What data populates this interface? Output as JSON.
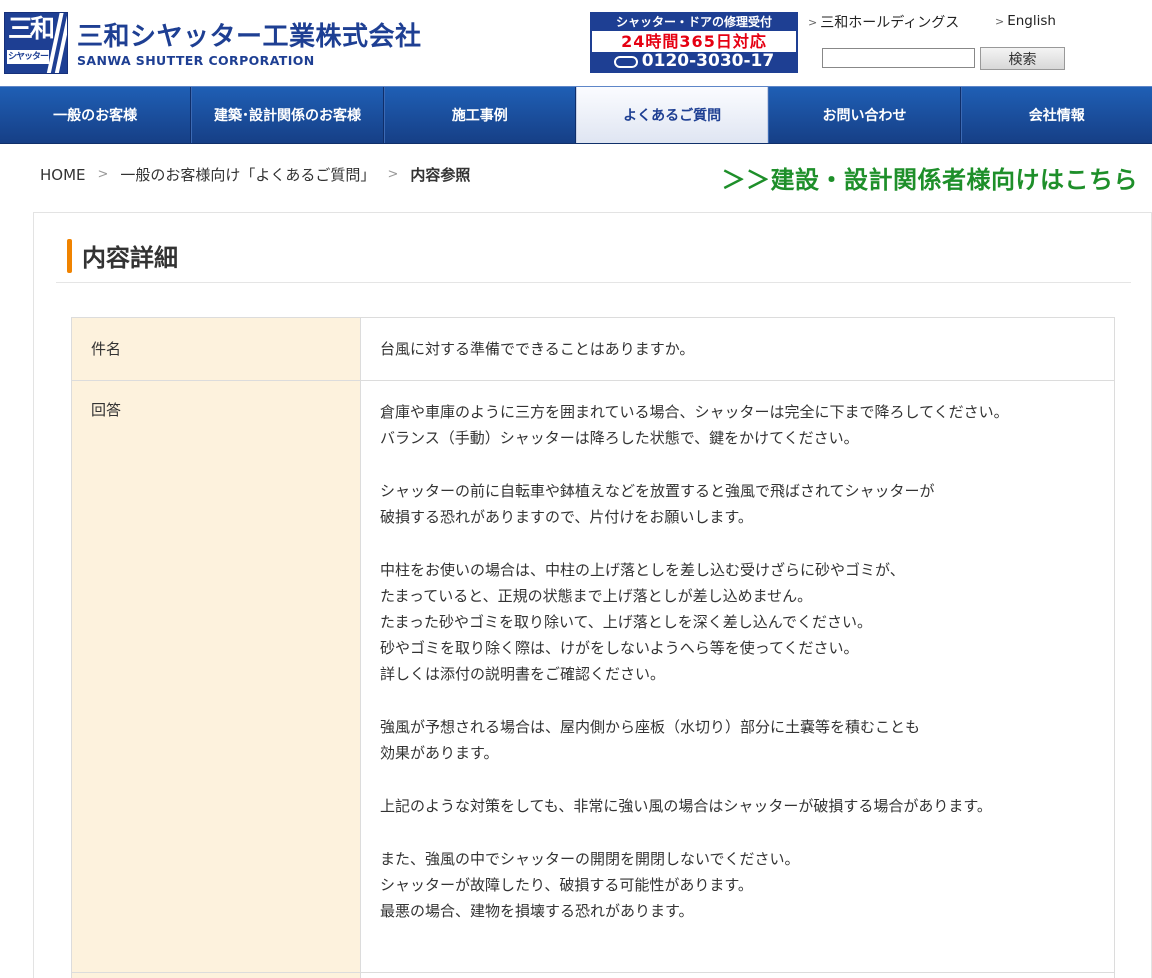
{
  "header": {
    "logo_mark_top": "三和",
    "logo_mark_bottom": "シヤッター",
    "company_name_jp": "三和シヤッター工業株式会社",
    "company_name_en": "SANWA SHUTTER CORPORATION",
    "repair_banner": {
      "line1": "シャッター・ドアの修理受付",
      "line2": "24時間365日対応",
      "phone": "0120-3030-17"
    },
    "links": {
      "holdings": "三和ホールディングス",
      "english": "English"
    },
    "search": {
      "value": "",
      "placeholder": "",
      "button_label": "検索"
    }
  },
  "nav": {
    "items": [
      {
        "label": "一般のお客様",
        "active": false
      },
      {
        "label": "建築･設計関係のお客様",
        "active": false
      },
      {
        "label": "施工事例",
        "active": false
      },
      {
        "label": "よくあるご質問",
        "active": true
      },
      {
        "label": "お問い合わせ",
        "active": false
      },
      {
        "label": "会社情報",
        "active": false
      }
    ]
  },
  "breadcrumb": {
    "home": "HOME",
    "faq": "一般のお客様向け「よくあるご質問」",
    "current": "内容参照"
  },
  "construction_link": "＞＞建設・設計関係者様向けはこちら",
  "content": {
    "title": "内容詳細",
    "subject_label": "件名",
    "subject_value": "台風に対する準備でできることはありますか。",
    "answer_label": "回答",
    "answer_paragraphs": [
      [
        "倉庫や車庫のように三方を囲まれている場合、シャッターは完全に下まで降ろしてください。",
        "バランス（手動）シャッターは降ろした状態で、鍵をかけてください。"
      ],
      [
        "シャッターの前に自転車や鉢植えなどを放置すると強風で飛ばされてシャッターが",
        "破損する恐れがありますので、片付けをお願いします。"
      ],
      [
        "中柱をお使いの場合は、中柱の上げ落としを差し込む受けざらに砂やゴミが、",
        "たまっていると、正規の状態まで上げ落としが差し込めません。",
        "たまった砂やゴミを取り除いて、上げ落としを深く差し込んでください。",
        "砂やゴミを取り除く際は、けがをしないようへら等を使ってください。",
        "詳しくは添付の説明書をご確認ください。"
      ],
      [
        "強風が予想される場合は、屋内側から座板（水切り）部分に土嚢等を積むことも",
        "効果があります。"
      ],
      [
        "上記のような対策をしても、非常に強い風の場合はシャッターが破損する場合があります。"
      ],
      [
        "また、強風の中でシャッターの開閉を開閉しないでください。",
        "シャッターが故障したり、破損する可能性があります。",
        "最悪の場合、建物を損壊する恐れがあります。"
      ]
    ]
  },
  "colors": {
    "brand_blue": "#1e3f93",
    "accent_orange": "#f08300",
    "link_green": "#1e8f2a",
    "label_bg": "#fdf2dd"
  }
}
